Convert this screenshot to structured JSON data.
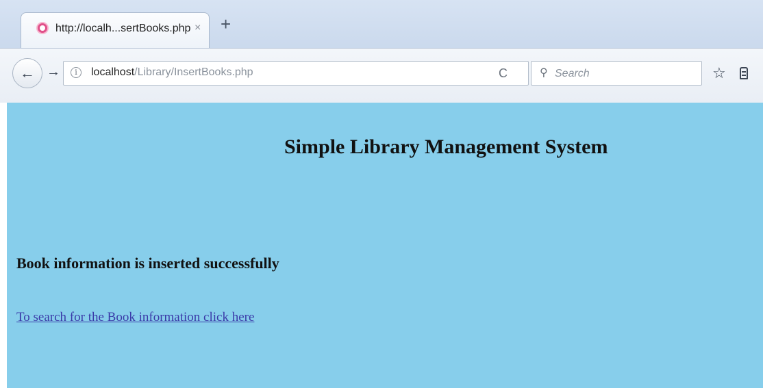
{
  "browser": {
    "tab": {
      "title": "http://localh...sertBooks.php",
      "close_glyph": "×",
      "favicon": "page-favicon-icon"
    },
    "new_tab_glyph": "+",
    "address_bar": {
      "host": "localhost",
      "path": "/Library/InsertBooks.php"
    },
    "search_bar": {
      "placeholder": "Search"
    },
    "icons": {
      "back": "←",
      "forward": "→",
      "info": "i",
      "reload": "C",
      "search": "⚲",
      "bookmark": "☆"
    }
  },
  "page": {
    "background_color": "#87ceeb",
    "heading": "Simple Library Management System",
    "message": "Book information is inserted successfully",
    "link_text": "To search for the Book information click here",
    "link_color": "#3a3aa8"
  }
}
